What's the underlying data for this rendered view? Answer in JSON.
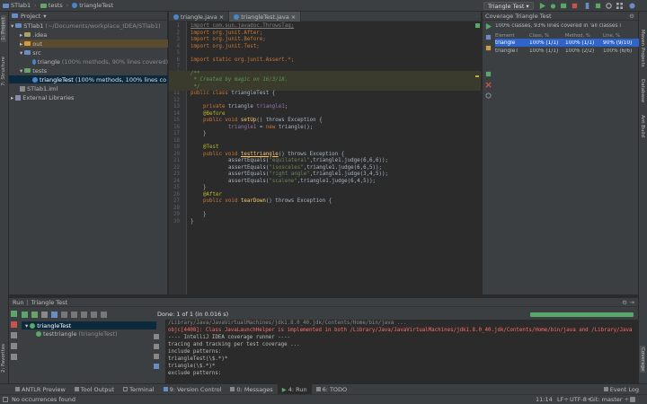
{
  "colors": {
    "accent": "#2f65ca",
    "run_green": "#59a869",
    "error_red": "#ff6b68",
    "bg_editor": "#2b2b2b",
    "bg_panel": "#3c3f41"
  },
  "toolbar": {
    "breadcrumbs": [
      "STlab1",
      "tests",
      "triangleTest"
    ],
    "run_config": "Triangle Test"
  },
  "left_strip": {
    "project": "1: Project",
    "structure": "7: Structure",
    "favorites": "2: Favorites"
  },
  "right_strip": {
    "maven": "Maven Projects",
    "database": "Database",
    "ant": "Ant Build",
    "coverage": "Coverage"
  },
  "project": {
    "header": "Project",
    "root": "STlab1",
    "root_path": "(~/Documents/workplace_IDEA/STlab1)",
    "idea": ".idea",
    "out": "out",
    "src": "src",
    "src_triangle": "triangle",
    "src_triangle_cov": "(100% methods, 90% lines covered)",
    "tests": "tests",
    "tests_triangleTest": "triangleTest",
    "tests_triangleTest_cov": "(100% methods, 100% lines co",
    "iml": "STlab1.iml",
    "ext": "External Libraries"
  },
  "editor": {
    "tabs": [
      {
        "label": "triangle.java"
      },
      {
        "label": "triangleTest.java"
      }
    ],
    "lines": [
      "1",
      "2",
      "3",
      "4",
      "5",
      "6",
      "7",
      "8",
      "9",
      "10",
      "11",
      "12",
      "13",
      "14",
      "15",
      "16",
      "17",
      "18",
      "19",
      "20",
      "21",
      "22",
      "23",
      "24",
      "25",
      "26",
      "27",
      "28",
      "29",
      "30"
    ],
    "code": {
      "imp1": "import com.sun.javadoc.ThrowsTag;",
      "imp2": "import org.junit.After;",
      "imp3": "import org.junit.Before;",
      "imp4": "import org.junit.Test;",
      "imp5": "import static org.junit.Assert.*;",
      "c1": "/**",
      "c2": " * Created by magic on 16/3/18.",
      "c3": " */",
      "class_kw": "public class ",
      "class_name": "triangleTest",
      "brace_open": " {",
      "private_kw": "private ",
      "type_triangle": "triangle ",
      "field": "triangle1",
      "semicolon": ";",
      "before": "@Before",
      "public_void": "public void ",
      "setUp": "setUp",
      "throws_exc": "() throws Exception {",
      "assign_eq": " = ",
      "new_kw": "new ",
      "ctor": "triangle();",
      "close_brace": "}",
      "test_ann": "@Test",
      "testtriangle": "testtriangle",
      "assert1": "assertEquals(",
      "s_equilateral": "\"equilateral\"",
      "a1_tail": ",triangle1.judge(6,6,6));",
      "s_isosceles": "\"isosceles\"",
      "a2_tail": ",triangle1.judge(6,6,5));",
      "s_right": "\"right angle\"",
      "a3_tail": ",triangle1.judge(3,4,5));",
      "s_scalene": "\"scalene\"",
      "a4_tail": ",triangle1.judge(6,4,5));",
      "after": "@After",
      "tearDown": "tearDown"
    }
  },
  "coverage": {
    "title": "Coverage Triangle Test",
    "summary": "100% classes, 93% lines covered in 'all classes i",
    "columns": [
      "Element",
      "Class, %",
      "Method, %",
      "Line, %"
    ],
    "rows": [
      {
        "element": "triangle",
        "class": "100% (1/1)",
        "method": "100% (1/1)",
        "line": "90% (9/10)"
      },
      {
        "element": "triangleT",
        "class": "100% (1/1)",
        "method": "100% (2/2)",
        "line": "100% (6/6)"
      }
    ]
  },
  "run": {
    "title": "Run",
    "config": "Triangle Test",
    "done": "Done: 1 of 1 (in 0.016 s)",
    "tree_root": "triangleTest",
    "tree_child": "testtriangle",
    "tree_child_cls": "(triangleTest)",
    "console": [
      "/Library/Java/JavaVirtualMachines/jdk1.8.0_40.jdk/Contents/Home/bin/java ...",
      "objc[4408]: Class JavaLaunchHelper is implemented in both /Library/Java/JavaVirtualMachines/jdk1.8.0_40.jdk/Contents/Home/bin/java and /Library/Java",
      "---- IntelliJ IDEA coverage runner ----",
      "tracing and tracking per test coverage ...",
      "include patterns:",
      "triangleTest(\\$.*)*",
      "triangle(\\$.*)*",
      "exclude patterns:"
    ]
  },
  "bottom_tabs": [
    "ANTLR Preview",
    "Tool Output",
    "Terminal",
    "9: Version Control",
    "0: Messages",
    "4: Run",
    "6: TODO"
  ],
  "event_log": "Event Log",
  "status": {
    "left": "No occurrences found",
    "pos": "11:14",
    "lf": "LF÷",
    "enc": "UTF-8÷",
    "git": "Git: master ÷"
  }
}
